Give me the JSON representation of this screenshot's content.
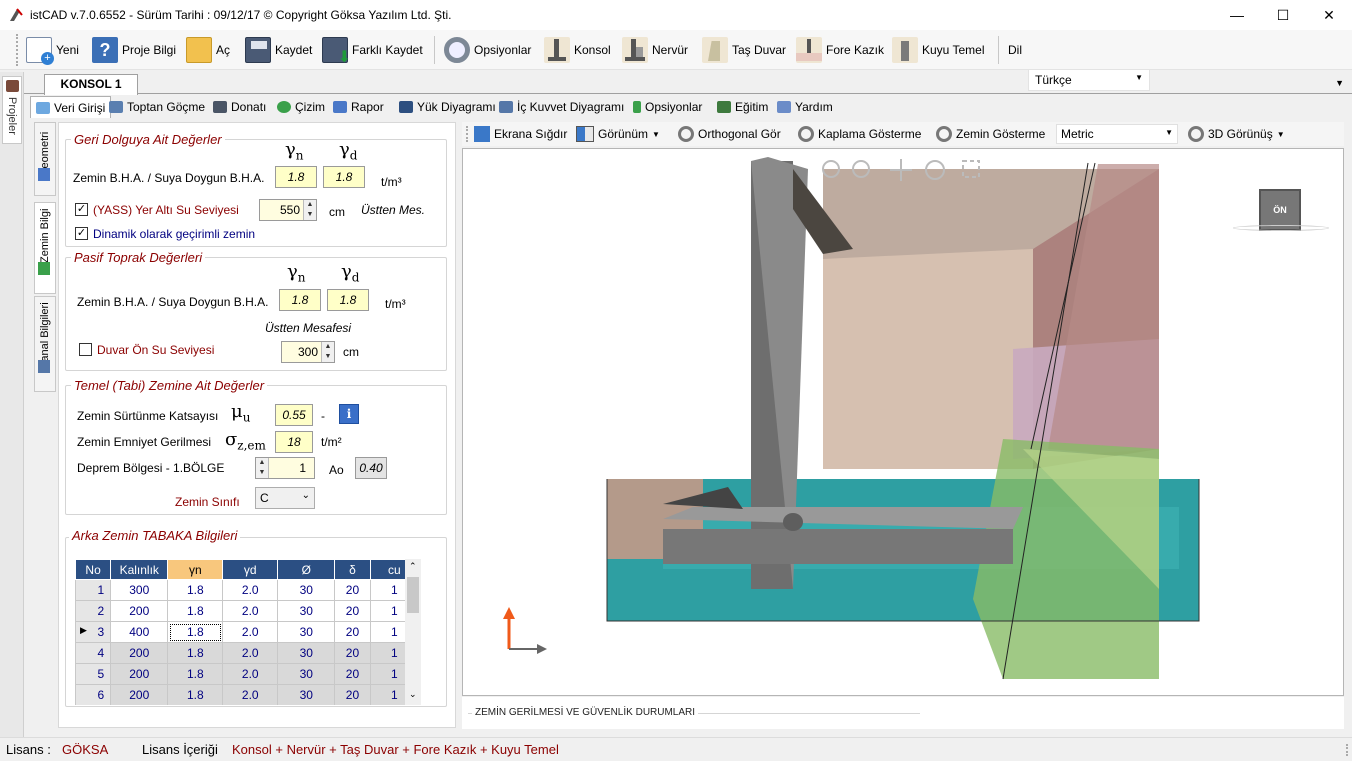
{
  "window": {
    "title": "istCAD v.7.0.6552 -  Sürüm Tarihi : 09/12/17  © Copyright Göksa Yazılım Ltd. Şti.",
    "minimize": "—",
    "maximize": "☐",
    "close": "✕"
  },
  "toolbar": {
    "new": "Yeni",
    "project_info": "Proje Bilgi",
    "open": "Aç",
    "save": "Kaydet",
    "save_as": "Farklı Kaydet",
    "options": "Opsiyonlar",
    "konsol": "Konsol",
    "nervur": "Nervür",
    "tas_duvar": "Taş Duvar",
    "fore_kazik": "Fore Kazık",
    "kuyu_temel": "Kuyu Temel",
    "language_label": "Dil",
    "language_value": "Türkçe"
  },
  "left_strip": {
    "label": "Projeler"
  },
  "doc_tab": {
    "label": "KONSOL 1"
  },
  "sub_tabs": [
    "Veri Girişi",
    "Toptan Göçme",
    "Donatı",
    "Çizim",
    "Rapor",
    "Yük Diyagramı",
    "İç Kuvvet Diyagramı",
    "Opsiyonlar",
    "Eğitim",
    "Yardım"
  ],
  "vertical_tabs": [
    "Geometri",
    "Zemin Bilgi",
    "Kanal Bilgileri"
  ],
  "backfill": {
    "title": "Geri Dolguya Ait Değerler",
    "gamma_n": "γ",
    "gamma_n_sub": "n",
    "gamma_d": "γ",
    "gamma_d_sub": "d",
    "label": "Zemin B.H.A. / Suya Doygun B.H.A.",
    "yn": "1.8",
    "yd": "1.8",
    "unit": "t/m³",
    "yass_checked": "☑",
    "yass_label": "(YASS) Yer Altı Su Seviyesi",
    "yass_value": "550",
    "yass_unit": "cm",
    "yass_ref": "Üstten Mes.",
    "dyn_checked": "☑",
    "dyn_label": "Dinamik olarak geçirimli zemin"
  },
  "passive": {
    "title": "Pasif Toprak Değerleri",
    "gamma_n": "γ",
    "gamma_n_sub": "n",
    "gamma_d": "γ",
    "gamma_d_sub": "d",
    "label": "Zemin B.H.A. / Suya Doygun B.H.A.",
    "yn": "1.8",
    "yd": "1.8",
    "unit": "t/m³",
    "top_dist": "Üstten Mesafesi",
    "water_checked": "☐",
    "water_label": "Duvar Ön Su Seviyesi",
    "water_value": "300",
    "water_unit": "cm"
  },
  "foundation": {
    "title": "Temel (Tabi) Zemine Ait Değerler",
    "friction_label": "Zemin Sürtünme Katsayısı",
    "mu": "μ",
    "mu_sub": "u",
    "friction_value": "0.55",
    "friction_unit": "-",
    "info": "i",
    "stress_label": "Zemin Emniyet Gerilmesi",
    "sigma": "σ",
    "sigma_sub": "z,em",
    "stress_value": "18",
    "stress_unit": "t/m²",
    "quake_label": "Deprem Bölgesi  - 1.BÖLGE",
    "quake_value": "1",
    "ao_label": "Ao",
    "ao_value": "0.40",
    "class_label": "Zemin Sınıfı",
    "class_value": "C"
  },
  "layers": {
    "title": "Arka Zemin TABAKA Bilgileri",
    "columns": [
      "No",
      "Kalınlık",
      "γn",
      "γd",
      "Ø",
      "δ",
      "cu"
    ],
    "rows": [
      [
        "1",
        "300",
        "1.8",
        "2.0",
        "30",
        "20",
        "1"
      ],
      [
        "2",
        "200",
        "1.8",
        "2.0",
        "30",
        "20",
        "1"
      ],
      [
        "3",
        "400",
        "1.8",
        "2.0",
        "30",
        "20",
        "1"
      ],
      [
        "4",
        "200",
        "1.8",
        "2.0",
        "30",
        "20",
        "1"
      ],
      [
        "5",
        "200",
        "1.8",
        "2.0",
        "30",
        "20",
        "1"
      ],
      [
        "6",
        "200",
        "1.8",
        "2.0",
        "30",
        "20",
        "1"
      ]
    ],
    "current_row_marker": "▶"
  },
  "viewport_toolbar": {
    "fit": "Ekrana Sığdır",
    "view": "Görünüm",
    "ortho": "Orthogonal Gör",
    "cover": "Kaplama Gösterme",
    "ground": "Zemin Gösterme",
    "unit": "Metric",
    "view3d": "3D Görünüş"
  },
  "viewcube": {
    "label": "ÖN"
  },
  "bottom_panel": {
    "title": "ZEMİN GERİLMESİ VE GÜVENLİK DURUMLARI"
  },
  "status": {
    "license_label": "Lisans :",
    "license_value": "GÖKSA",
    "content_label": "Lisans İçeriği",
    "content_value": "Konsol + Nervür + Taş Duvar + Fore Kazık + Kuyu Temel"
  },
  "colors": {
    "accent_red": "#8b0000",
    "header_blue": "#2b4f83",
    "selected_header": "#f8c77d",
    "input_yellow": "#ffffc8",
    "water_teal": "#2e9fa2"
  }
}
